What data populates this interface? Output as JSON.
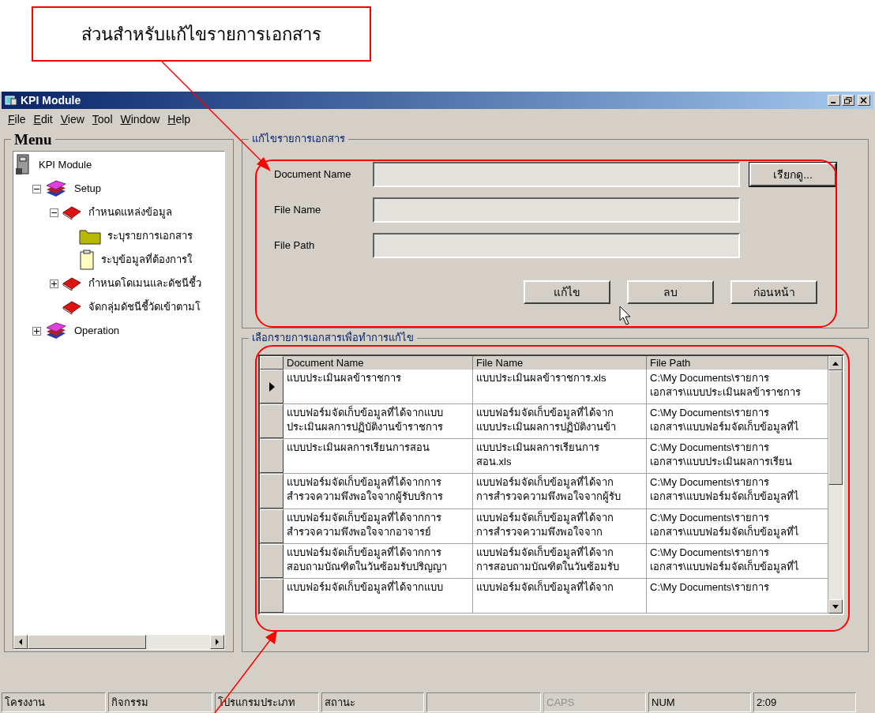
{
  "callout": {
    "text": "ส่วนสำหรับแก้ไขรายการเอกสาร"
  },
  "window": {
    "title": "KPI Module"
  },
  "menu": [
    "File",
    "Edit",
    "View",
    "Tool",
    "Window",
    "Help"
  ],
  "sidebar": {
    "title": "Menu",
    "tree": [
      {
        "label": "KPI Module",
        "kind": "computer",
        "children": [
          {
            "label": "Setup",
            "kind": "books",
            "expanded": true,
            "children": [
              {
                "label": "กำหนดแหล่งข้อมูล",
                "kind": "book",
                "expanded": true,
                "children": [
                  {
                    "label": "ระบุรายการเอกสาร",
                    "kind": "folder"
                  },
                  {
                    "label": "ระบุข้อมูลที่ต้องการใ",
                    "kind": "clipboard"
                  }
                ]
              },
              {
                "label": "กำหนดโดเมนและดัชนีชี้ว",
                "kind": "book",
                "expanded": false
              },
              {
                "label": "จัดกลุ่มดัชนีชี้วัดเข้าตามโ",
                "kind": "book"
              }
            ]
          },
          {
            "label": "Operation",
            "kind": "books",
            "expanded": false
          }
        ]
      }
    ]
  },
  "edit_group": {
    "title": "แก้ไขรายการเอกสาร",
    "fields": [
      {
        "label": "Document Name"
      },
      {
        "label": "File Name"
      },
      {
        "label": "File Path"
      }
    ],
    "browse_button": "เรียกดู...",
    "buttons": [
      "แก้ไข",
      "ลบ",
      "ก่อนหน้า"
    ]
  },
  "list_group": {
    "title": "เลือกรายการเอกสารเพื่อทำการแก้ไข",
    "table": {
      "columns": [
        "Document Name",
        "File Name",
        "File Path"
      ],
      "rows": [
        {
          "selected": true,
          "cells": [
            [
              "แบบประเมินผลข้าราชการ"
            ],
            [
              "แบบประเมินผลข้าราชการ.xls"
            ],
            [
              "C:\\My Documents\\รายการ",
              "เอกสาร\\แบบประเมินผลข้าราชการ"
            ]
          ]
        },
        {
          "selected": false,
          "cells": [
            [
              "แบบฟอร์มจัดเก็บข้อมูลที่ได้จากแบบ",
              "ประเมินผลการปฏิบัติงานข้าราชการ"
            ],
            [
              "แบบฟอร์มจัดเก็บข้อมูลที่ได้จาก",
              "แบบประเมินผลการปฏิบัติงานข้า"
            ],
            [
              "C:\\My Documents\\รายการ",
              "เอกสาร\\แบบฟอร์มจัดเก็บข้อมูลที่ไ"
            ]
          ]
        },
        {
          "selected": false,
          "cells": [
            [
              "แบบประเมินผลการเรียนการสอน"
            ],
            [
              "แบบประเมินผลการเรียนการ",
              "สอน.xls"
            ],
            [
              "C:\\My Documents\\รายการ",
              "เอกสาร\\แบบประเมินผลการเรียน"
            ]
          ]
        },
        {
          "selected": false,
          "cells": [
            [
              "แบบฟอร์มจัดเก็บข้อมูลที่ได้จากการ",
              "สำรวจความพึงพอใจจากผู้รับบริการ"
            ],
            [
              "แบบฟอร์มจัดเก็บข้อมูลที่ได้จาก",
              "การสำรวจความพึงพอใจจากผู้รับ"
            ],
            [
              "C:\\My Documents\\รายการ",
              "เอกสาร\\แบบฟอร์มจัดเก็บข้อมูลที่ไ"
            ]
          ]
        },
        {
          "selected": false,
          "cells": [
            [
              "แบบฟอร์มจัดเก็บข้อมูลที่ได้จากการ",
              "สำรวจความพึงพอใจจากอาจารย์"
            ],
            [
              "แบบฟอร์มจัดเก็บข้อมูลที่ได้จาก",
              "การสำรวจความพึงพอใจจาก"
            ],
            [
              "C:\\My Documents\\รายการ",
              "เอกสาร\\แบบฟอร์มจัดเก็บข้อมูลที่ไ"
            ]
          ]
        },
        {
          "selected": false,
          "cells": [
            [
              "แบบฟอร์มจัดเก็บข้อมูลที่ได้จากการ",
              "สอบถามบัณฑิตในวันซ้อมรับปริญญา"
            ],
            [
              "แบบฟอร์มจัดเก็บข้อมูลที่ได้จาก",
              "การสอบถามบัณฑิตในวันซ้อมรับ"
            ],
            [
              "C:\\My Documents\\รายการ",
              "เอกสาร\\แบบฟอร์มจัดเก็บข้อมูลที่ไ"
            ]
          ]
        },
        {
          "selected": false,
          "cells": [
            [
              "แบบฟอร์มจัดเก็บข้อมูลที่ได้จากแบบ"
            ],
            [
              "แบบฟอร์มจัดเก็บข้อมูลที่ได้จาก"
            ],
            [
              "C:\\My Documents\\รายการ"
            ]
          ]
        }
      ]
    }
  },
  "status_bar": [
    {
      "text": "โครงงาน",
      "disabled": false
    },
    {
      "text": "กิจกรรม",
      "disabled": false
    },
    {
      "text": "โปรแกรมประเภท",
      "disabled": false
    },
    {
      "text": "สถานะ",
      "disabled": false
    },
    {
      "disabled": false
    },
    {
      "text": "CAPS",
      "disabled": true
    },
    {
      "text": "NUM",
      "disabled": false
    },
    {
      "text": "2:09",
      "disabled": false
    }
  ]
}
